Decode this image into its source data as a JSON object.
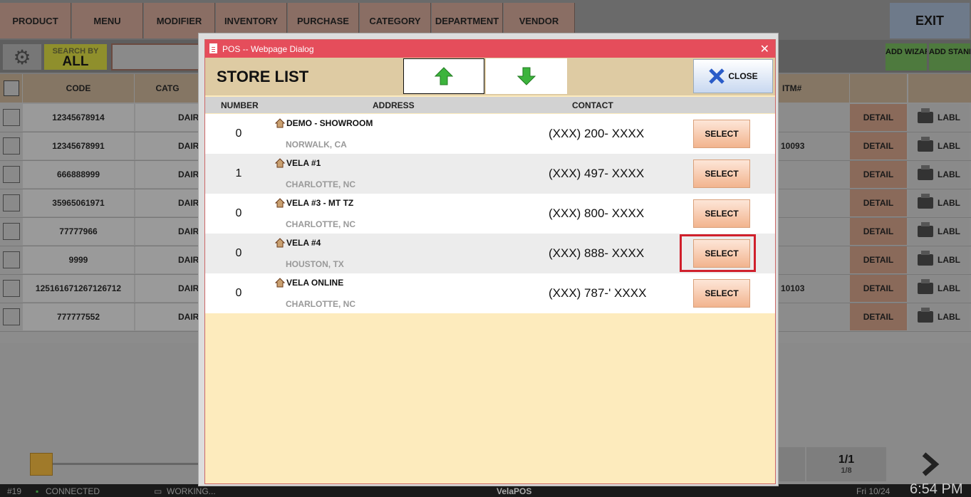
{
  "nav": {
    "items": [
      "PRODUCT",
      "MENU",
      "MODIFIER",
      "INVENTORY",
      "PURCHASE",
      "CATEGORY",
      "DEPARTMENT",
      "VENDOR"
    ],
    "exit_label": "EXIT"
  },
  "toolbar": {
    "search_by_label": "SEARCH BY",
    "search_by_value": "ALL",
    "add_wizard_label": "ADD WIZARD",
    "add_standard_label": "ADD STANDARD"
  },
  "grid": {
    "headers": {
      "code": "CODE",
      "category": "CATG",
      "itm": "ITM#"
    },
    "rows": [
      {
        "code": "12345678914",
        "category": "DAIR",
        "itm": ""
      },
      {
        "code": "12345678991",
        "category": "DAIR",
        "itm": "10093"
      },
      {
        "code": "666888999",
        "category": "DAIR",
        "itm": ""
      },
      {
        "code": "35965061971",
        "category": "DAIR",
        "itm": ""
      },
      {
        "code": "77777966",
        "category": "DAIR",
        "itm": ""
      },
      {
        "code": "9999",
        "category": "DAIR",
        "itm": ""
      },
      {
        "code": "125161671267126712",
        "category": "DAIR",
        "itm": "10103"
      },
      {
        "code": "777777552",
        "category": "DAIR",
        "itm": ""
      }
    ],
    "detail_label": "DETAIL",
    "labl_label": "LABL"
  },
  "pager": {
    "page": "1/1",
    "sub": "1/8"
  },
  "status": {
    "terminal": "#19",
    "connection": "CONNECTED",
    "working": "WORKING...",
    "app": "VelaPOS",
    "date": "Fri 10/24",
    "time": "6:54 PM"
  },
  "dialog": {
    "window_title": "POS -- Webpage Dialog",
    "title": "STORE LIST",
    "close_label": "CLOSE",
    "columns": {
      "number": "NUMBER",
      "address": "ADDRESS",
      "contact": "CONTACT"
    },
    "select_label": "SELECT",
    "stores": [
      {
        "number": "0",
        "name": "DEMO - SHOWROOM",
        "city": "NORWALK, CA",
        "contact": "(XXX) 200- XXXX"
      },
      {
        "number": "1",
        "name": "VELA #1",
        "city": "CHARLOTTE, NC",
        "contact": "(XXX) 497- XXXX"
      },
      {
        "number": "0",
        "name": "VELA #3 - MT TZ",
        "city": "CHARLOTTE, NC",
        "contact": "(XXX) 800- XXXX"
      },
      {
        "number": "0",
        "name": "VELA #4",
        "city": "HOUSTON, TX",
        "contact": "(XXX) 888- XXXX"
      },
      {
        "number": "0",
        "name": "VELA ONLINE",
        "city": "CHARLOTTE, NC",
        "contact": "(XXX) 787-' XXXX"
      }
    ]
  },
  "colors": {
    "dialog_titlebar": "#e54d5b",
    "dialog_body": "#fdebbd",
    "highlight": "#d0202c",
    "arrow_green": "#3cb43c"
  }
}
